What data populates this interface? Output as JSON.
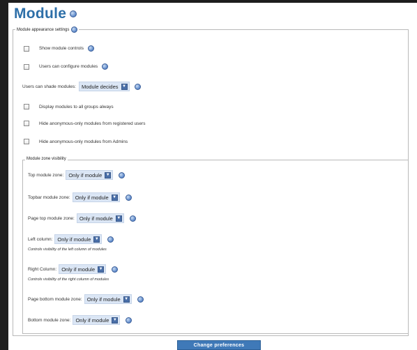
{
  "title": "Module",
  "appearance": {
    "legend": "Module appearance settings",
    "show_module_controls": "Show module controls",
    "users_configure": "Users can configure modules",
    "users_shade_label": "Users can shade modules:",
    "users_shade_value": "Module decides",
    "display_all_groups": "Display modules to all groups always",
    "hide_anon_registered": "Hide anonymous-only modules from registered users",
    "hide_anon_admins": "Hide anonymous-only modules from Admins"
  },
  "visibility": {
    "legend": "Module zone visibility",
    "zones": [
      {
        "label": "Top module zone:",
        "value": "Only if module"
      },
      {
        "label": "Topbar module zone:",
        "value": "Only if module"
      },
      {
        "label": "Page top module zone:",
        "value": "Only if module"
      },
      {
        "label": "Left column:",
        "value": "Only if module",
        "desc": "Controls visibility of the left column of modules"
      },
      {
        "label": "Right Column:",
        "value": "Only if module",
        "desc": "Controls visibility of the right column of modules"
      },
      {
        "label": "Page bottom module zone:",
        "value": "Only if module"
      },
      {
        "label": "Bottom module zone:",
        "value": "Only if module"
      }
    ]
  },
  "submit_label": "Change preferences",
  "icons": {
    "help": "help-icon",
    "dropdown": "chevron-down-icon"
  },
  "colors": {
    "title": "#2d6fa8",
    "button": "#3f79b8",
    "select_bg": "#dbe6f5"
  }
}
